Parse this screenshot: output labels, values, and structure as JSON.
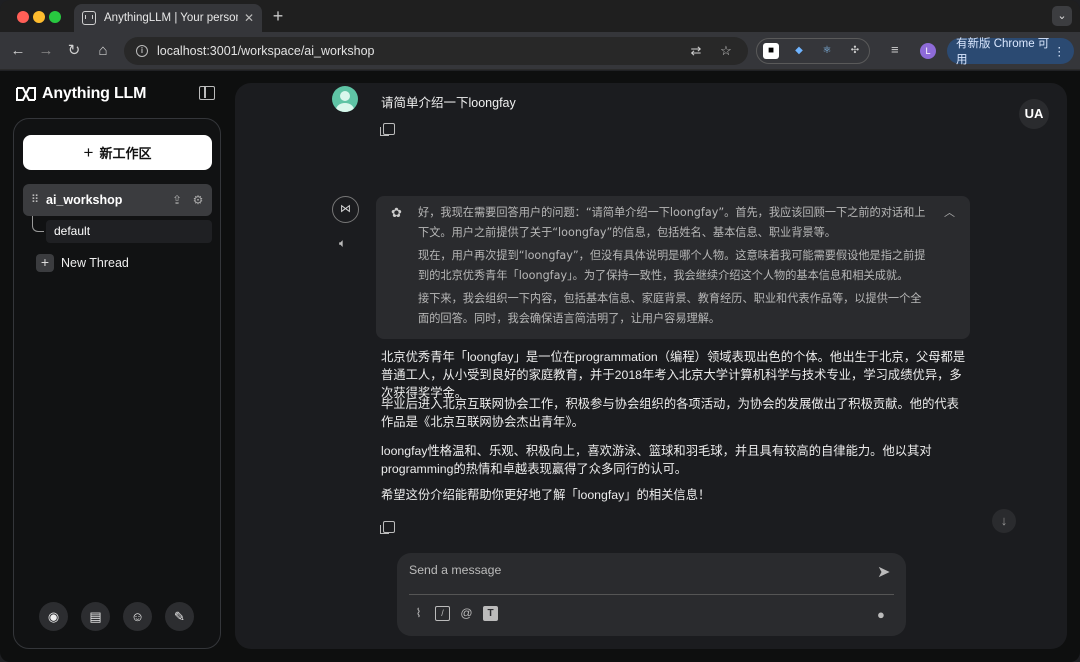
{
  "browser": {
    "tab_title": "AnythingLLM | Your personal",
    "tab_close": "✕",
    "new_tab": "+",
    "tab_menu": "⌄",
    "url": "localhost:3001/workspace/ai_workshop",
    "profile_initial": "L",
    "update_label": "有新版 Chrome 可用"
  },
  "app": {
    "logo_text": "Anything LLM",
    "sidebar": {
      "new_workspace_label": "新工作区",
      "workspace_name": "ai_workshop",
      "thread_name": "default",
      "new_thread_label": "New Thread"
    },
    "user_initials": "UA",
    "user_message": "请简单介绍一下loongfay",
    "thought": {
      "p1": "好，我现在需要回答用户的问题：“请简单介绍一下loongfay”。首先，我应该回顾一下之前的对话和上下文。用户之前提供了关于“loongfay”的信息，包括姓名、基本信息、职业背景等。",
      "p2": "现在，用户再次提到“loongfay”，但没有具体说明是哪个人物。这意味着我可能需要假设他是指之前提到的北京优秀青年「loongfay」。为了保持一致性，我会继续介绍这个人物的基本信息和相关成就。",
      "p3": "接下来，我会组织一下内容，包括基本信息、家庭背景、教育经历、职业和代表作品等，以提供一个全面的回答。同时，我会确保语言简洁明了，让用户容易理解。"
    },
    "answer": {
      "p1": "北京优秀青年「loongfay」是一位在programmation（编程）领域表现出色的个体。他出生于北京，父母都是普通工人，从小受到良好的家庭教育，并于2018年考入北京大学计算机科学与技术专业，学习成绩优异，多次获得奖学金。",
      "p2": "毕业后进入北京互联网协会工作，积极参与协会组织的各项活动，为协会的发展做出了积极贡献。他的代表作品是《北京互联网协会杰出青年》。",
      "p3": "loongfay性格温和、乐观、积极向上，喜欢游泳、篮球和羽毛球，并且具有较高的自律能力。他以其对programming的热情和卓越表现赢得了众多同行的认可。",
      "p4": "希望这份介绍能帮助你更好地了解「loongfay」的相关信息！"
    },
    "composer_placeholder": "Send a message"
  }
}
